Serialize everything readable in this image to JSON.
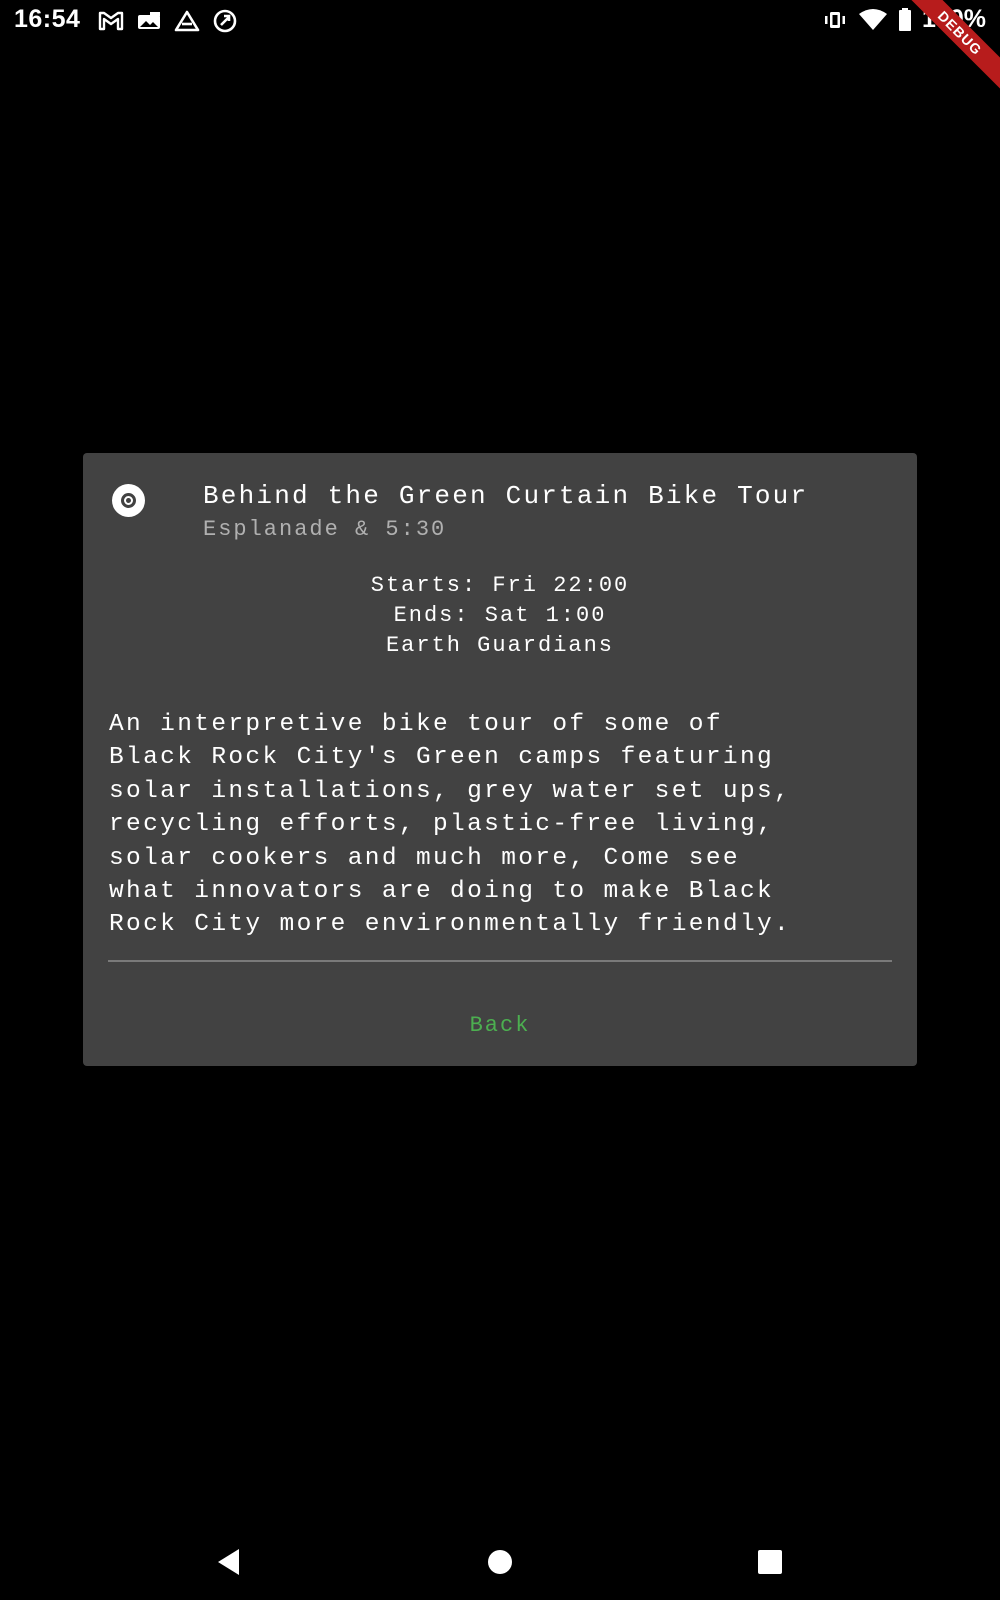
{
  "status_bar": {
    "time": "16:54",
    "battery_percent": "100%",
    "icons_left": [
      "gmail-icon",
      "photo-icon",
      "drive-icon",
      "sync-icon"
    ],
    "icons_right": [
      "vibrate-icon",
      "wifi-icon",
      "battery-icon"
    ]
  },
  "debug_banner": {
    "label": "DEBUG",
    "color": "#b71c1c"
  },
  "dialog": {
    "icon": "radio-target-icon",
    "title": "Behind the Green Curtain Bike Tour",
    "subtitle": "Esplanade & 5:30",
    "starts": "Starts: Fri 22:00",
    "ends": "Ends: Sat 1:00",
    "host": "Earth Guardians",
    "description_lines": [
      "An interpretive bike tour of some of",
      "Black Rock City's Green camps featuring",
      "solar installations, grey water set ups,",
      "recycling efforts, plastic-free living,",
      "solar cookers and much more, Come see",
      "what innovators are doing to make Black",
      "Rock City more environmentally friendly."
    ],
    "back_label": "Back",
    "background": "#424242",
    "accent": "#4caf50"
  },
  "nav_bar": {
    "buttons": [
      "back-triangle-icon",
      "home-circle-icon",
      "recents-square-icon"
    ]
  }
}
